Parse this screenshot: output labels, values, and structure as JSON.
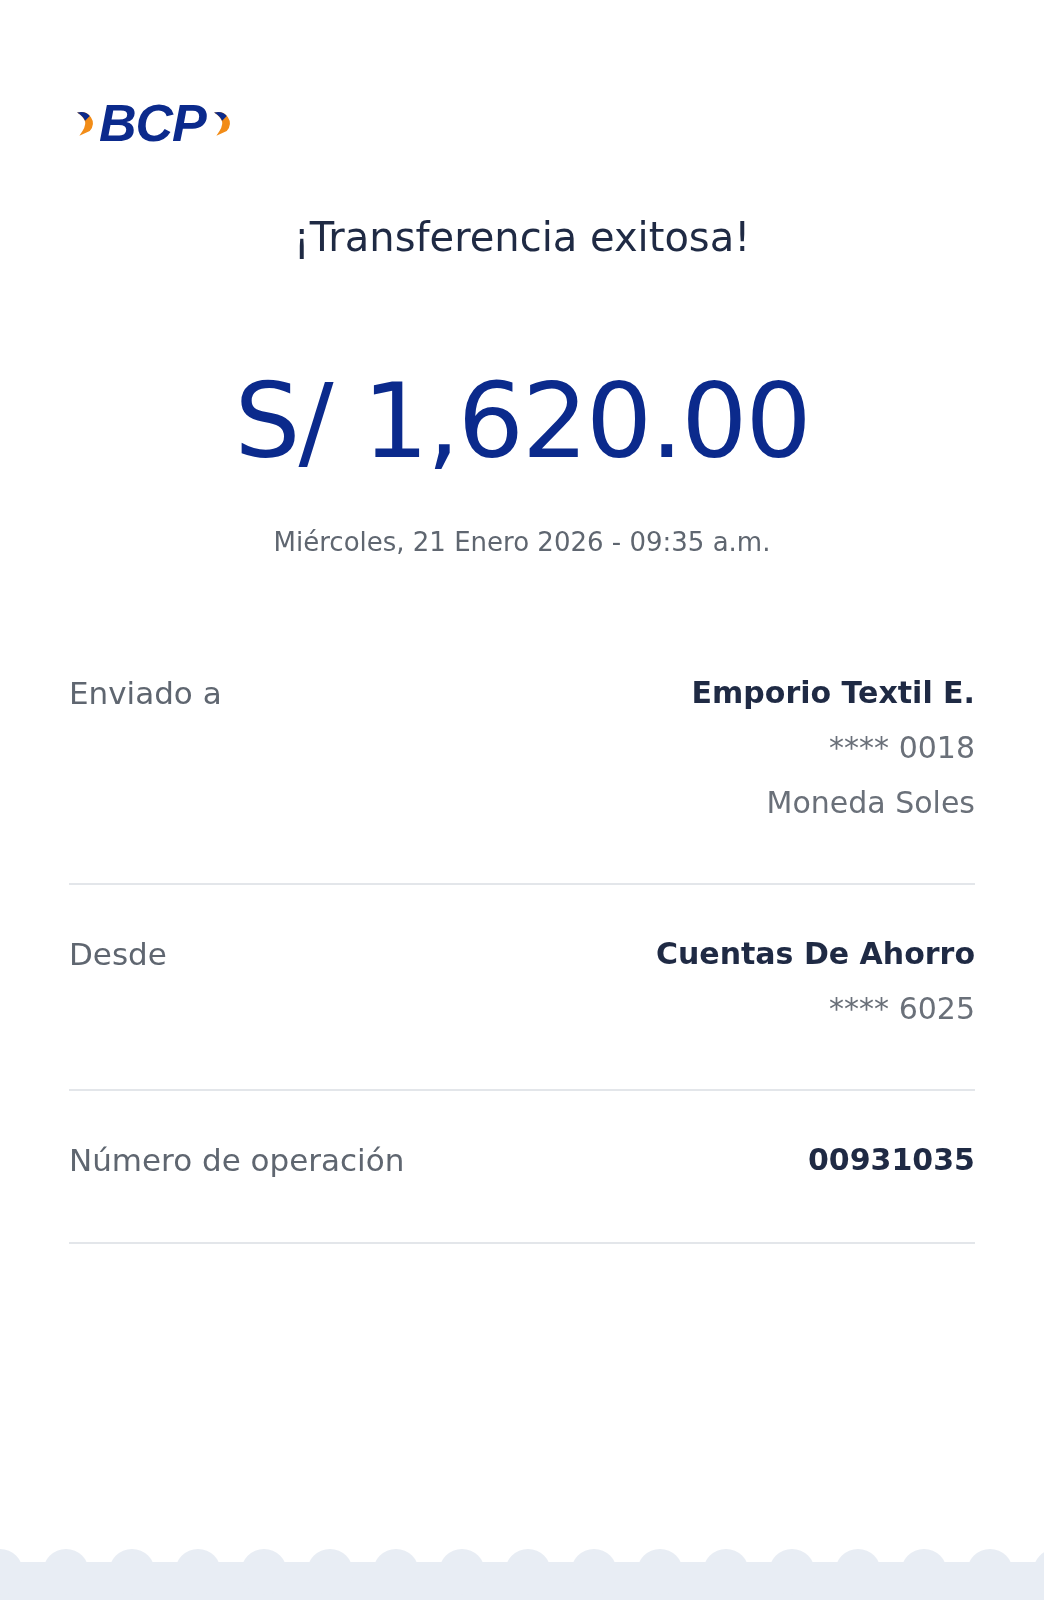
{
  "logo": {
    "text": "BCP"
  },
  "title": "¡Transferencia exitosa!",
  "amount": "S/ 1,620.00",
  "datetime": "Miércoles, 21 Enero 2026 - 09:35 a.m.",
  "details": [
    {
      "label": "Enviado a",
      "lines": [
        {
          "text": "Emporio Textil E.",
          "kind": "primary"
        },
        {
          "text": "**** 0018",
          "kind": "secondary"
        },
        {
          "text": "Moneda Soles",
          "kind": "secondary"
        }
      ]
    },
    {
      "label": "Desde",
      "lines": [
        {
          "text": "Cuentas De Ahorro",
          "kind": "primary"
        },
        {
          "text": "**** 6025",
          "kind": "secondary"
        }
      ]
    },
    {
      "label": "Número de operación",
      "lines": [
        {
          "text": "00931035",
          "kind": "primary"
        }
      ]
    }
  ]
}
